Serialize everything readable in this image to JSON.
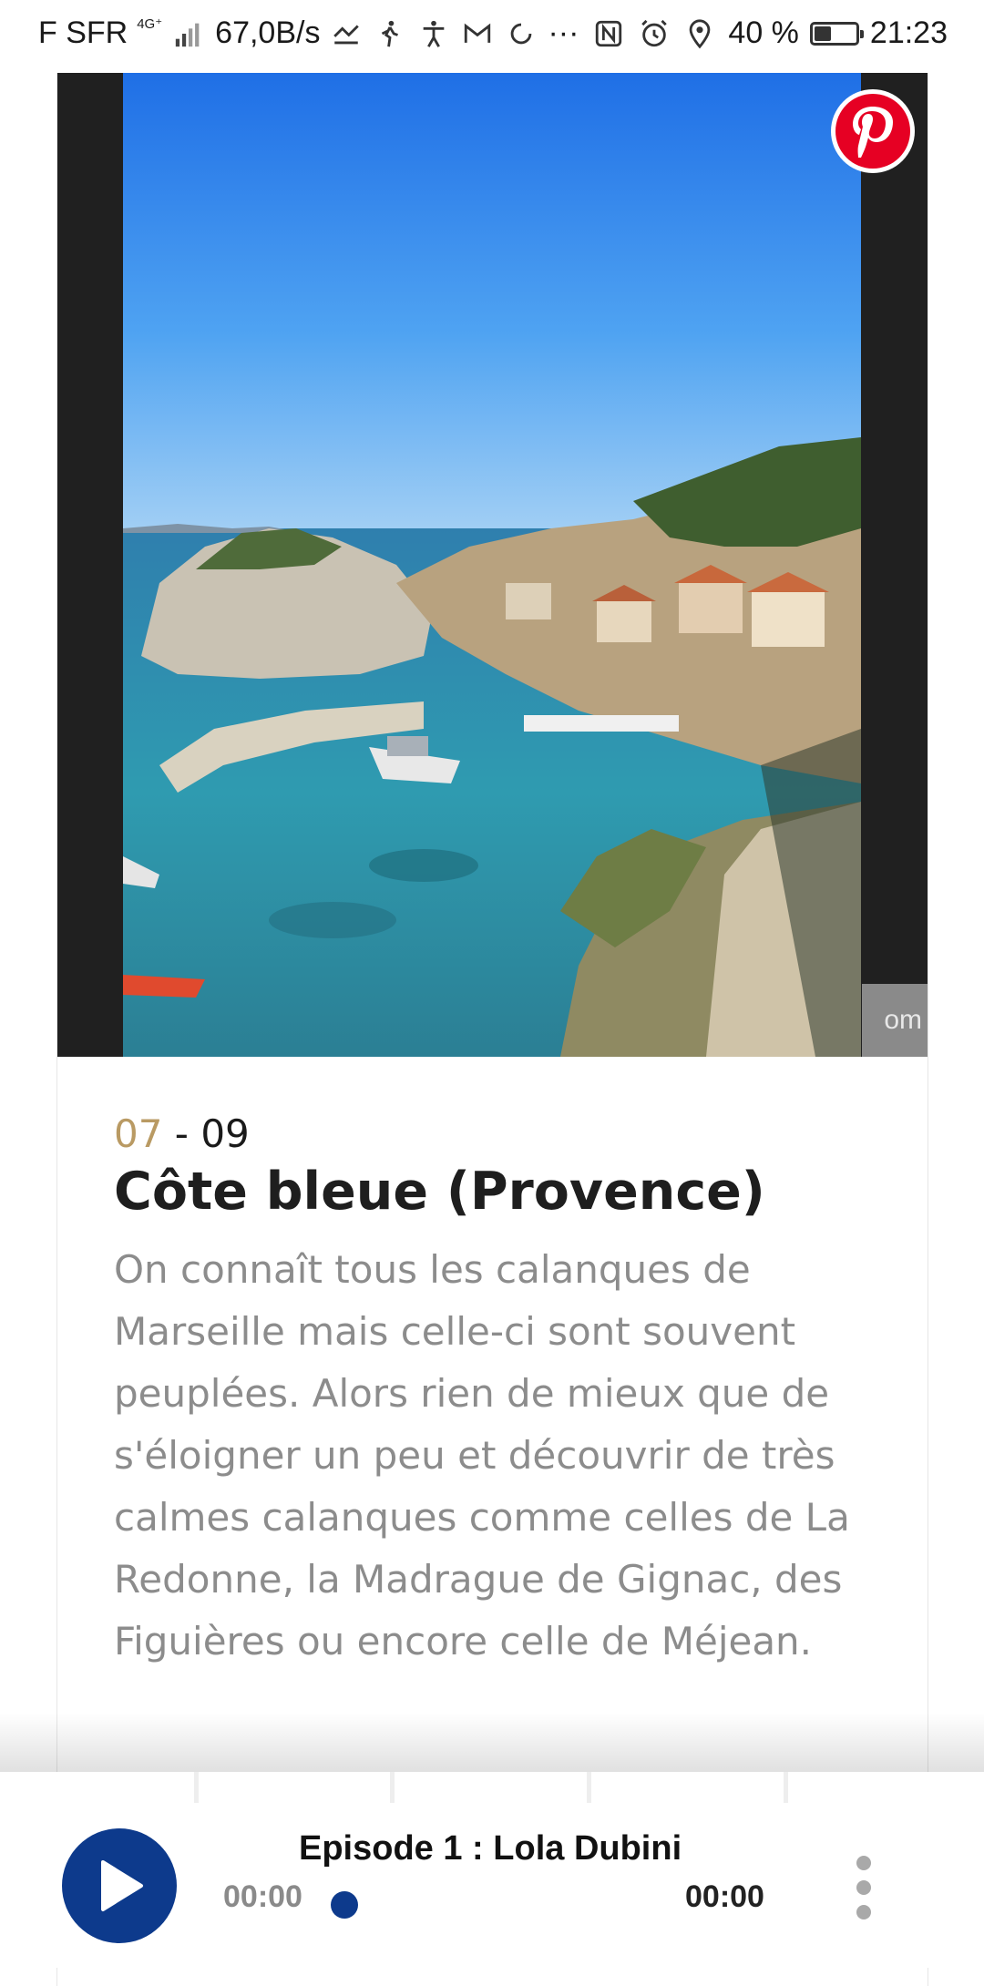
{
  "status_bar": {
    "carrier": "F SFR",
    "network": "4G⁺",
    "speed": "67,0B/s",
    "more": "···",
    "battery": "40 %",
    "battery_level": 0.4,
    "time": "21:23"
  },
  "article": {
    "image_credit": "om",
    "slide_current": "07",
    "slide_separator": " - ",
    "slide_total": "09",
    "title": "Côte bleue (Provence)",
    "description": "On connaît tous les calanques de Marseille mais celle-ci sont souvent peuplées. Alors rien de mieux que de s'éloigner un peu et découvrir de très calmes calanques comme celles de La Redonne, la Madrague de Gignac, des Figuières ou encore celle de Méjean."
  },
  "player": {
    "episode_title": "Episode 1 : Lola Dubini",
    "time_elapsed": "00:00",
    "time_total": "00:00",
    "progress": 0.05
  },
  "colors": {
    "accent_gold": "#b99a63",
    "player_blue": "#0d3a8c",
    "pinterest_red": "#e60023"
  },
  "icons": [
    "signal-icon",
    "do-not-disturb-icon",
    "walking-icon",
    "accessibility-icon",
    "gmail-icon",
    "sync-icon",
    "nfc-icon",
    "alarm-icon",
    "location-icon",
    "battery-icon",
    "pinterest-icon",
    "play-icon",
    "more-vertical-icon"
  ]
}
